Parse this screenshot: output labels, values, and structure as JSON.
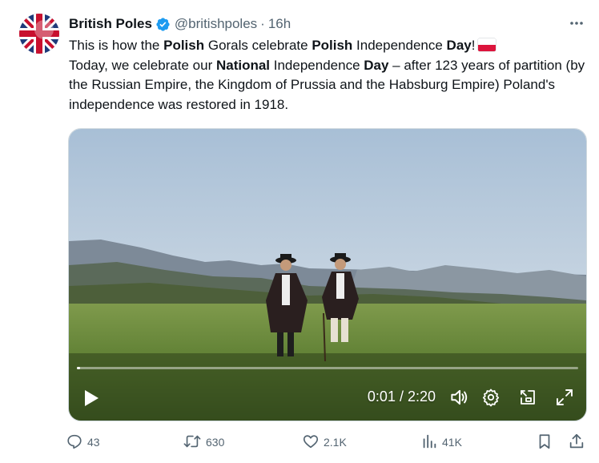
{
  "tweet": {
    "display_name": "British Poles",
    "handle": "@britishpoles",
    "separator": "·",
    "time": "16h",
    "text": {
      "p1": "This is how the ",
      "b1": "Polish",
      "p2": " Gorals celebrate ",
      "b2": "Polish",
      "p3": " Independence ",
      "b3": "Day",
      "p4": "!",
      "p5": "Today, we celebrate our ",
      "b4": "National",
      "p6": " Independence ",
      "b5": "Day",
      "p7": " – after 123 years of partition (by the Russian Empire, the Kingdom of Prussia and the Habsburg Empire) Poland's independence was restored in 1918."
    }
  },
  "video": {
    "timecode": "0:01 / 2:20",
    "progress": 0.007
  },
  "actions": {
    "replies": "43",
    "retweets": "630",
    "likes": "2.1K",
    "views": "41K"
  },
  "icons": {
    "avatar": "union-jack-avatar",
    "verified": "verified-badge-icon",
    "more": "more-dots-icon",
    "flag": "poland-flag-icon",
    "play": "play-icon",
    "volume": "volume-icon",
    "settings": "gear-icon",
    "pip": "picture-in-picture-icon",
    "fullscreen": "fullscreen-icon",
    "reply": "reply-icon",
    "retweet": "retweet-icon",
    "like": "heart-icon",
    "views": "views-icon",
    "bookmark": "bookmark-icon",
    "share": "share-icon"
  },
  "colors": {
    "verified_blue": "#1d9bf0",
    "text_primary": "#0f1419",
    "text_secondary": "#536471",
    "flag_red": "#dc143c"
  }
}
